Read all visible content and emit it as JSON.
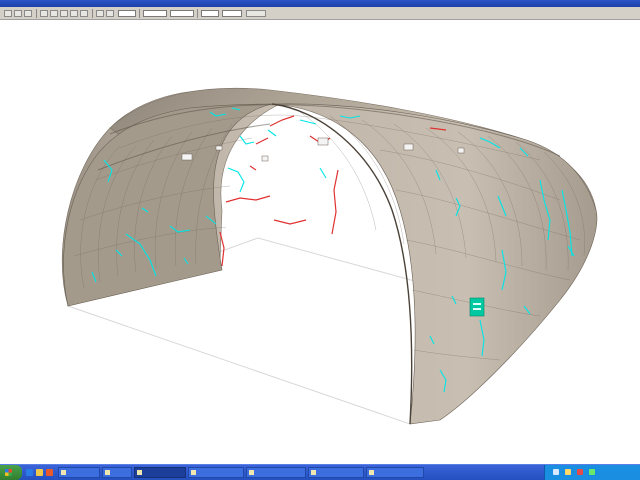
{
  "window": {
    "title": "",
    "accent_color": "#2450c0"
  },
  "toolbar": {
    "fields": [
      "",
      "",
      "",
      "",
      ""
    ],
    "buttons": [
      "",
      "",
      "",
      "",
      "",
      "",
      "",
      "",
      "",
      "",
      "",
      ""
    ]
  },
  "viewport": {
    "background": "#ffffff",
    "surface_color": "#b4aa9c",
    "crack_color_primary": "#00e6e6",
    "crack_color_secondary": "#e03030",
    "marker_color": "#00c8a0"
  },
  "taskbar": {
    "start_icon": "windows-logo-icon",
    "quick_launch_icons": [
      "ie-icon",
      "folder-icon",
      "media-icon"
    ],
    "tasks": [
      {
        "label": "",
        "active": false
      },
      {
        "label": "",
        "active": false
      },
      {
        "label": "",
        "active": true
      },
      {
        "label": "",
        "active": false
      },
      {
        "label": "",
        "active": false
      },
      {
        "label": "",
        "active": false
      },
      {
        "label": "",
        "active": false
      }
    ],
    "tray_icons": [
      "network-icon",
      "volume-icon",
      "security-icon",
      "update-icon",
      "clock-icon"
    ]
  }
}
